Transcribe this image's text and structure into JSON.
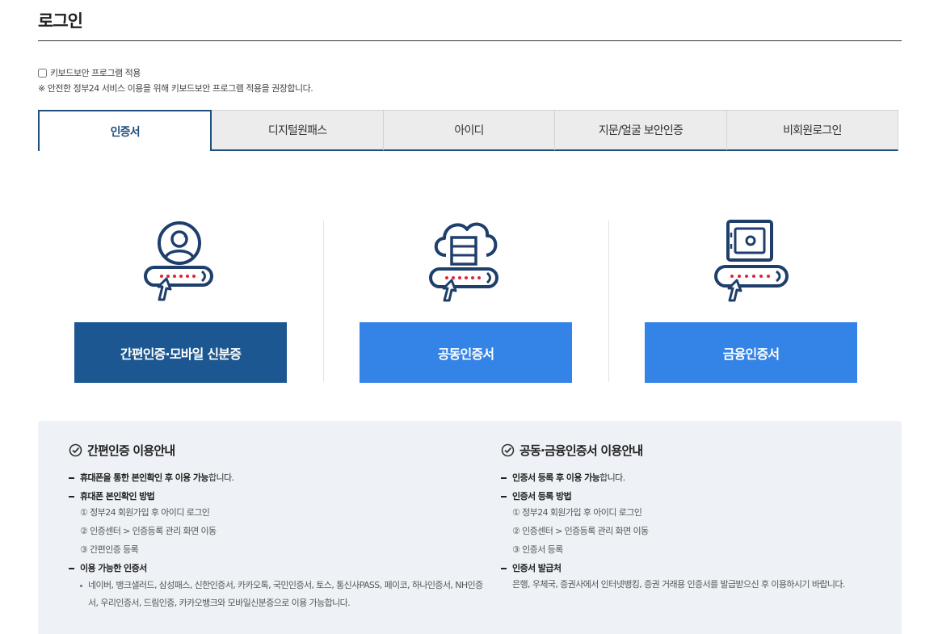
{
  "page": {
    "title": "로그인"
  },
  "keyboard": {
    "checkbox_label": "키보드보안 프로그램 적용",
    "notice": "※ 안전한 정부24 서비스 이용을 위해 키보드보안 프로그램 적용을 권장합니다."
  },
  "tabs": [
    {
      "label": "인증서",
      "active": true
    },
    {
      "label": "디지털원패스",
      "active": false
    },
    {
      "label": "아이디",
      "active": false
    },
    {
      "label": "지문/얼굴 보안인증",
      "active": false
    },
    {
      "label": "비회원로그인",
      "active": false
    }
  ],
  "methods": [
    {
      "label": "간편인증·모바일 신분증",
      "icon": "user-cert-icon"
    },
    {
      "label": "공동인증서",
      "icon": "cloud-server-cert-icon"
    },
    {
      "label": "금융인증서",
      "icon": "safe-cert-icon"
    }
  ],
  "guide": {
    "simple": {
      "title": "간편인증 이용안내",
      "item1_bold": "휴대폰을 통한 본인확인 후 이용 가능",
      "item1_rest": "합니다.",
      "item2_bold": "휴대폰 본인확인 방법",
      "steps": [
        "① 정부24 회원가입 후 아이디 로그인",
        "② 인증센터 > 인증등록 관리 화면 이동",
        "③ 간편인증 등록"
      ],
      "item3_bold": "이용 가능한 인증서",
      "providers_line1": "네이버, 뱅크샐러드, 삼성패스, 신한인증서, 카카오톡, 국민인증서, 토스, 통신사PASS, 페이코, 하나인증서, NH인증",
      "providers_line2": "서, 우리인증서, 드림인증, 카카오뱅크와 모바일신분증으로 이용 가능합니다."
    },
    "joint": {
      "title": "공동·금융인증서 이용안내",
      "item1_bold": "인증서 등록 후 이용 가능",
      "item1_rest": "합니다.",
      "item2_bold": "인증서 등록 방법",
      "steps": [
        "① 정부24 회원가입 후 아이디 로그인",
        "② 인증센터 > 인증등록 관리 화면 이동",
        "③ 인증서 등록"
      ],
      "item3_bold": "인증서 발급처",
      "issuer_text": "은행, 우체국, 증권사에서 인터넷뱅킹, 증권 거래용 인증서를 발급받으신 후 이용하시기 바랍니다."
    }
  },
  "colors": {
    "primary_dark": "#1c5791",
    "primary_light": "#3483e6",
    "icon_navy": "#1e3f6b",
    "dot_red": "#e0233a"
  }
}
